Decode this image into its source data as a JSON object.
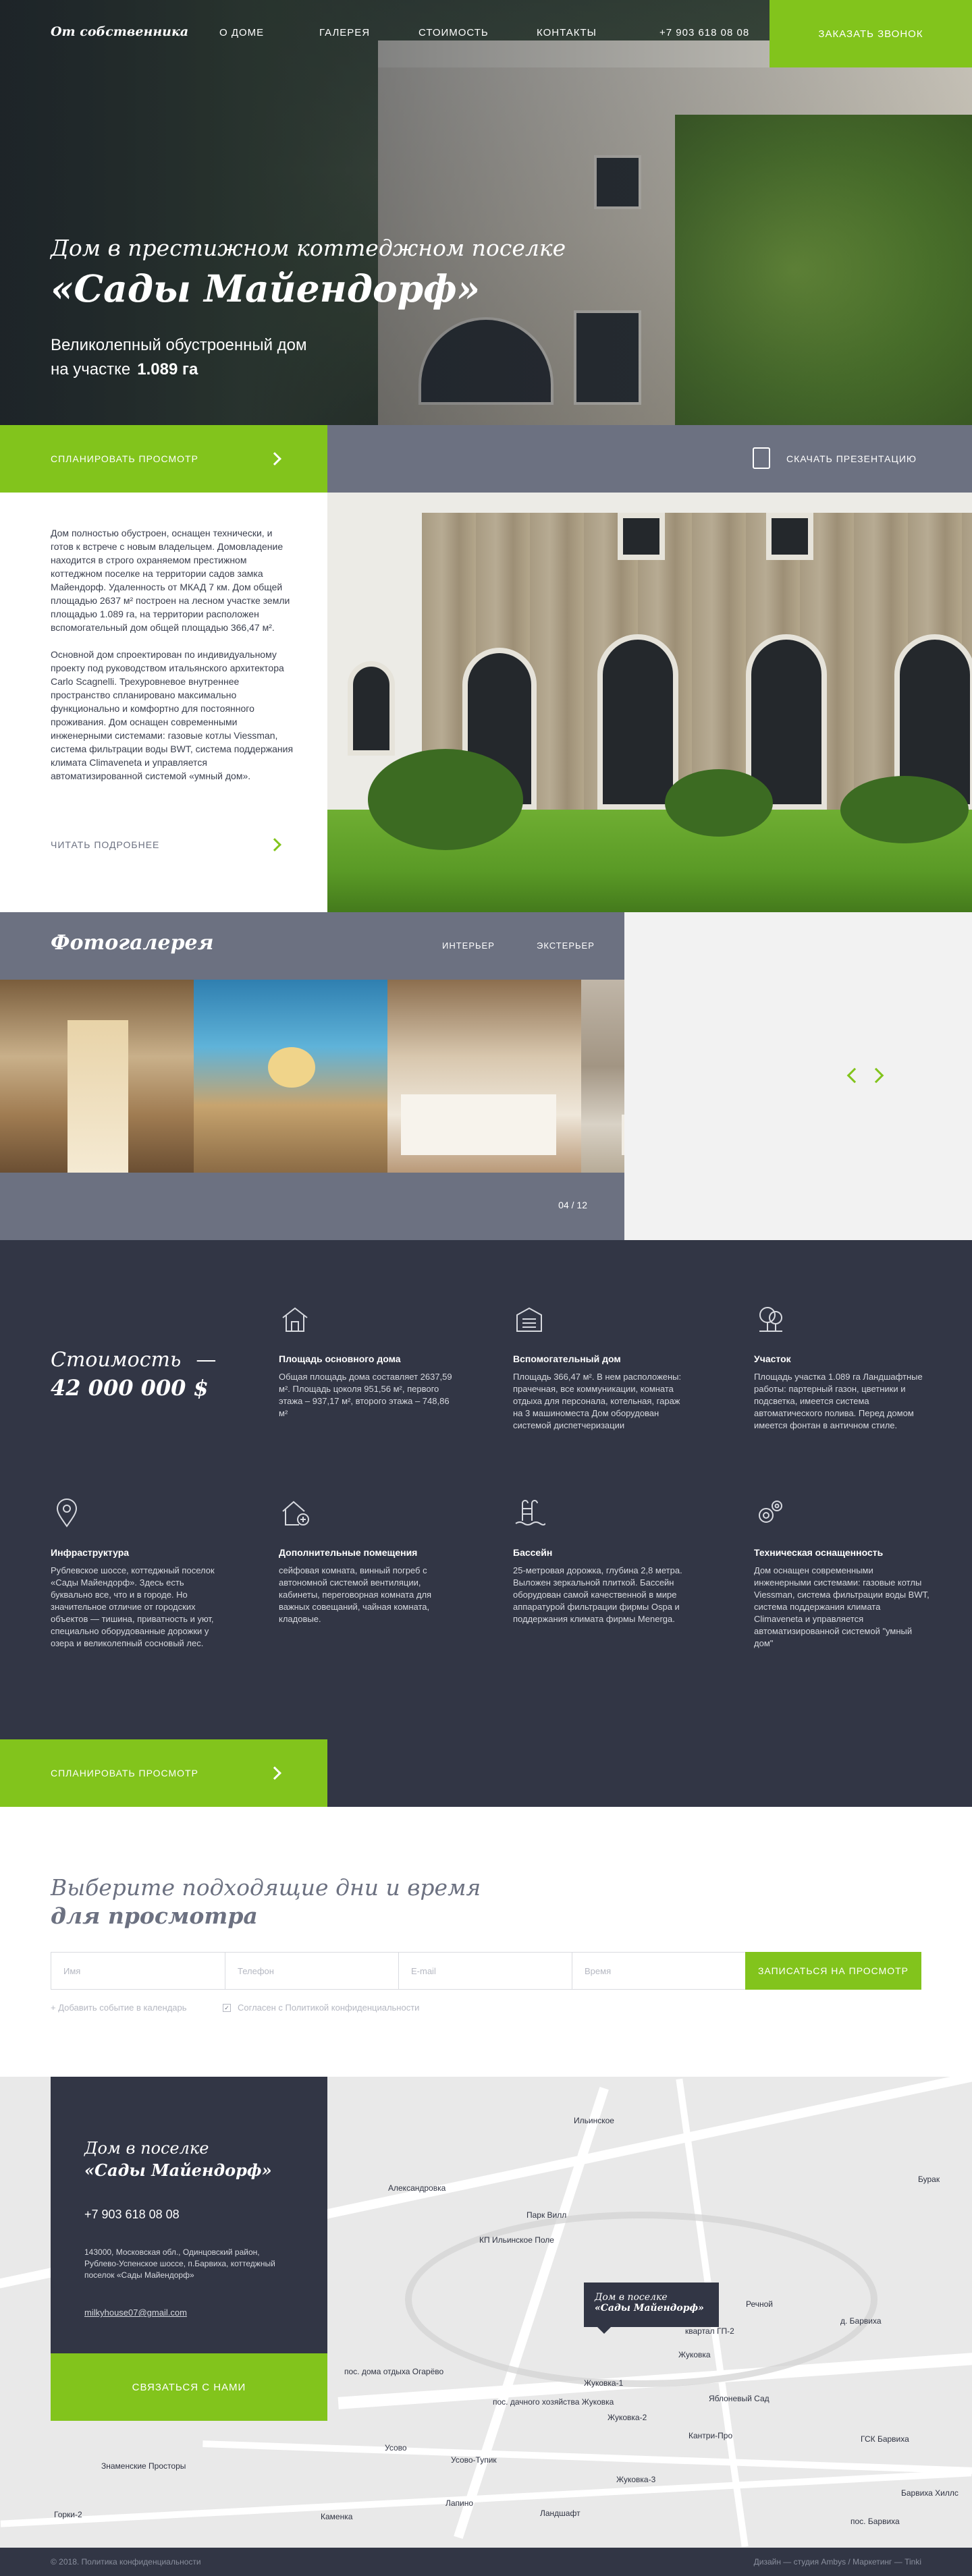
{
  "header": {
    "logo": "От собственника",
    "nav": [
      "О ДОМЕ",
      "ГАЛЕРЕЯ",
      "СТОИМОСТЬ",
      "КОНТАКТЫ"
    ],
    "phone": "+7 903 618 08 08",
    "cta": "ЗАКАЗАТЬ ЗВОНОК"
  },
  "hero": {
    "subtitle": "Дом в престижном коттеджном поселке",
    "title": "«Сады Майендорф»",
    "desc_line1": "Великолепный обустроенный дом",
    "desc_line2": "на участке",
    "area": "1.089 га"
  },
  "actions": {
    "plan_view": "СПЛАНИРОВАТЬ ПРОСМОТР",
    "download": "СКАЧАТЬ ПРЕЗЕНТАЦИЮ"
  },
  "about": {
    "p1": "Дом полностью обустроен, оснащен технически, и готов к встрече с новым владельцем. Домовладение находится в строго охраняемом престижном коттеджном поселке на территории садов замка Майендорф. Удаленность от МКАД 7 км. Дом общей площадью 2637 м² построен на лесном участке земли площадью 1.089 га, на территории расположен вспомогательный дом общей площадью 366,47 м².",
    "p2": "Основной дом спроектирован по индивидуальному проекту под руководством итальянского архитектора Carlo Scagnelli. Трехуровневое внутреннее пространство спланировано максимально функционально и комфортно для постоянного проживания. Дом оснащен современными инженерными системами: газовые котлы Viessman, система фильтрации воды BWT, система поддержания климата Climaveneta и управляется автоматизированной системой «умный дом».",
    "more": "ЧИТАТЬ ПОДРОБНЕЕ"
  },
  "gallery": {
    "title": "Фотогалерея",
    "tabs": [
      "ИНТЕРЬЕР",
      "ЭКСТЕРЬЕР"
    ],
    "counter": "04 / 12"
  },
  "price": {
    "label": "Стоимость",
    "value": "42 000 000 $",
    "features": [
      {
        "icon": "house-icon",
        "title": "Площадь основного дома",
        "text": "Общая площадь дома составляет 2637,59 м². Площадь цоколя 951,56 м², первого этажа – 937,17 м², второго этажа – 748,86 м²"
      },
      {
        "icon": "guest-house-icon",
        "title": "Вспомогательный дом",
        "text": "Площадь 366,47 м². В нем расположены: прачечная, все коммуникации, комната отдыха для персонала, котельная, гараж на 3 машиноместа Дом оборудован системой диспетчеризации"
      },
      {
        "icon": "tree-icon",
        "title": "Участок",
        "text": "Площадь участка 1.089 га Ландшафтные работы: партерный газон, цветники и подсветка, имеется система автоматического полива. Перед домом имеется фонтан в античном стиле."
      },
      {
        "icon": "location-pin-icon",
        "title": "Инфраструктура",
        "text": "Рублевское шоссе, коттеджный поселок «Сады Майендорф». Здесь есть буквально все, что и в городе. Но значительное отличие от городских объектов — тишина, приватность и уют, специально оборудованные дорожки у озера и великолепный сосновый лес."
      },
      {
        "icon": "house-plus-icon",
        "title": "Дополнительные помещения",
        "text": "сейфовая комната, винный погреб с автономной системой вентиляции, кабинеты, переговорная комната для важных совещаний, чайная комната, кладовые."
      },
      {
        "icon": "pool-icon",
        "title": "Бассейн",
        "text": "25-метровая дорожка, глубина 2,8 метра. Выложен зеркальной плиткой. Бассейн оборудован самой качественной в мире аппаратурой фильтрации фирмы Ospa и поддержания климата фирмы Menerga."
      },
      {
        "icon": "gears-icon",
        "title": "Техническая оснащенность",
        "text": "Дом оснащен современными инженерными системами: газовые котлы Viessman, система фильтрации воды BWT, система поддержания климата Climaveneta и управляется автоматизированной системой \"умный дом\""
      }
    ],
    "cta": "СПЛАНИРОВАТЬ ПРОСМОТР"
  },
  "booking": {
    "title1": "Выберите подходящие дни и время",
    "title2": "для просмотра",
    "name_ph": "Имя",
    "phone_ph": "Телефон",
    "email_ph": "E-mail",
    "time_ph": "Время",
    "submit": "ЗАПИСАТЬСЯ НА ПРОСМОТР",
    "calendar": "+ Добавить событие в календарь",
    "consent": "Согласен с Политикой конфиденциальности"
  },
  "contacts": {
    "title1": "Дом в поселке",
    "title2": "«Сады Майендорф»",
    "phone": "+7 903 618 08 08",
    "address": "143000, Московская обл., Одинцовский район, Рублево-Успенское шоссе, п.Барвиха, коттеджный поселок «Сады Майендорф»",
    "email": "milkyhouse07@gmail.com",
    "cta": "СВЯЗАТЬСЯ С НАМИ",
    "map_pin_1": "Дом в поселке",
    "map_pin_2": "«Сады Майендорф»",
    "map_labels": [
      "Ильинское",
      "Александровка",
      "Парк Вилл",
      "КП Ильинское Поле",
      "Речной",
      "Жуковка",
      "д. Барвиха",
      "пос. дома отдыха Огарёво",
      "пос. дачного хозяйства Жуковка",
      "Жуковка-1",
      "Жуковка-2",
      "Жуковка-3",
      "Усово",
      "Усово-Тупик",
      "Знаменские Просторы",
      "Горки-2",
      "Лапино",
      "Ландшафт",
      "Каменка",
      "пос. Барвиха",
      "Бурак",
      "ГСК Барвиха",
      "квартал ГП-2",
      "Кантри-Про",
      "Яблоневый Сад",
      "Барвиха Хиллс"
    ]
  },
  "footer": {
    "left": "© 2018. Политика конфиденциальности",
    "right": "Дизайн — студия Ambys / Маркетинг — Tinki"
  },
  "colors": {
    "accent": "#82c41c",
    "dark": "#323645",
    "gray": "#6c7181"
  }
}
